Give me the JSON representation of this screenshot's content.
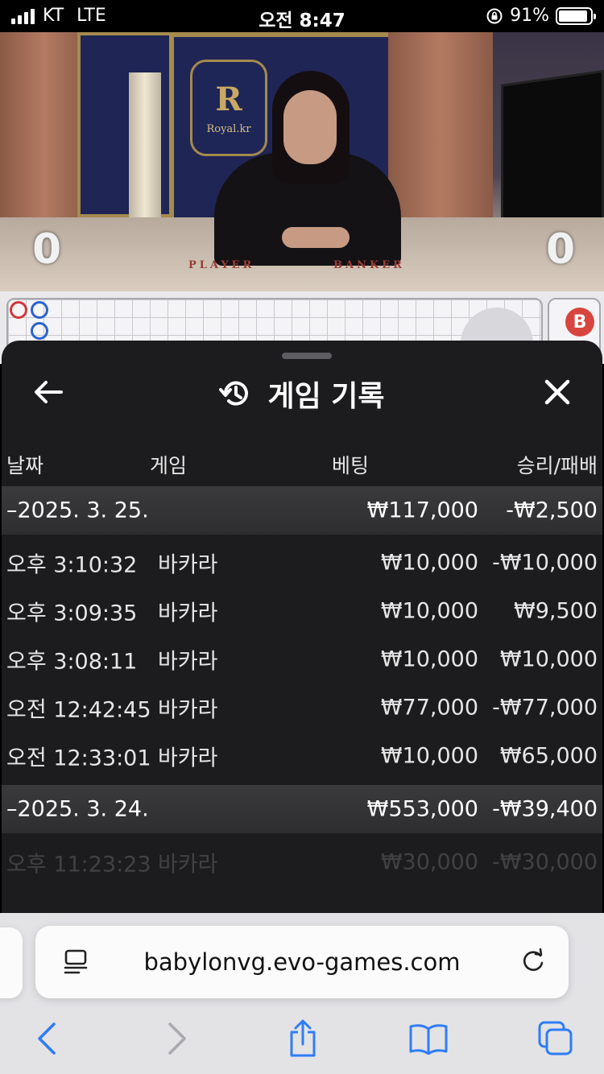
{
  "status_bar": {
    "carrier": "KT",
    "network": "LTE",
    "time": "오전 8:47",
    "battery": "91%",
    "battery_level": 0.91
  },
  "live_table": {
    "brand": "Royal.kr",
    "crest_letter": "R",
    "player_label": "PLAYER",
    "banker_label": "BANKER",
    "player_score": "0",
    "banker_score": "0"
  },
  "roads": {
    "side_marker": "B"
  },
  "history_sheet": {
    "title": "게임 기록",
    "icons": {
      "back": "arrow-left-icon",
      "history": "history-icon",
      "close": "close-icon"
    },
    "columns": {
      "date": "날짜",
      "game": "게임",
      "bet": "베팅",
      "win_loss": "승리/패배"
    },
    "groups": [
      {
        "date": "–2025. 3. 25.",
        "total_bet": "₩117,000",
        "total_result": "-₩2,500",
        "rows": [
          {
            "time": "오후 3:10:32",
            "game": "바카라",
            "bet": "₩10,000",
            "result": "-₩10,000"
          },
          {
            "time": "오후 3:09:35",
            "game": "바카라",
            "bet": "₩10,000",
            "result": "₩9,500"
          },
          {
            "time": "오후 3:08:11",
            "game": "바카라",
            "bet": "₩10,000",
            "result": "₩10,000"
          },
          {
            "time": "오전 12:42:45",
            "game": "바카라",
            "bet": "₩77,000",
            "result": "-₩77,000"
          },
          {
            "time": "오전 12:33:01",
            "game": "바카라",
            "bet": "₩10,000",
            "result": "₩65,000"
          }
        ]
      },
      {
        "date": "–2025. 3. 24.",
        "total_bet": "₩553,000",
        "total_result": "-₩39,400",
        "rows": [
          {
            "time": "오후 11:23:23",
            "game": "바카라",
            "bet": "₩30,000",
            "result": "-₩30,000"
          }
        ]
      }
    ]
  },
  "browser": {
    "url": "babylonvg.evo-games.com",
    "icons": [
      "reader-icon",
      "reload-icon",
      "back-icon",
      "forward-icon",
      "share-icon",
      "bookmarks-icon",
      "tabs-icon"
    ],
    "accent_color": "#2f7cf6"
  }
}
